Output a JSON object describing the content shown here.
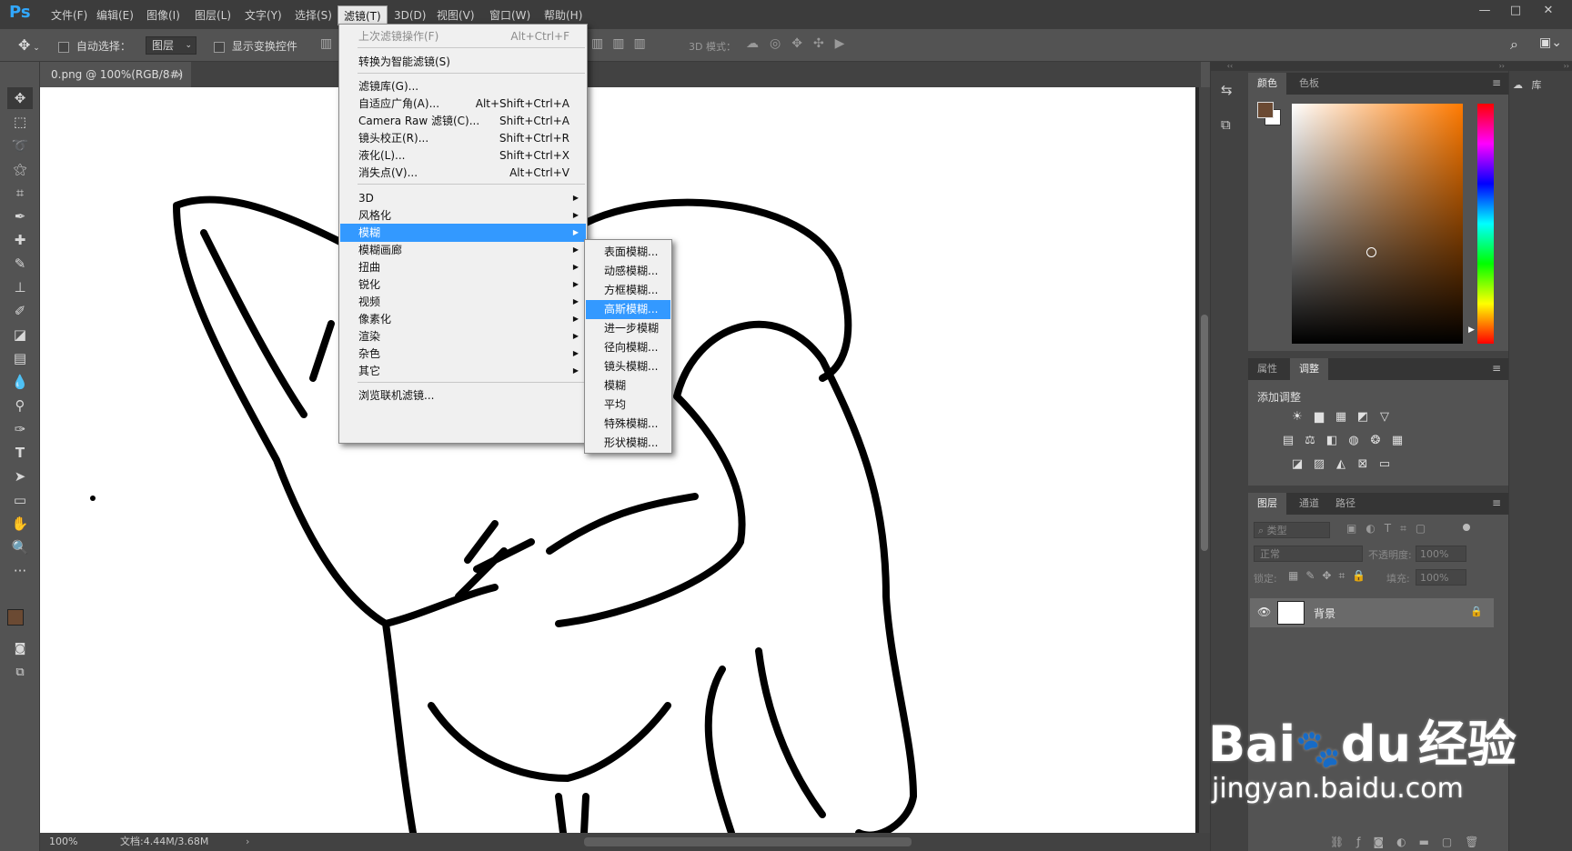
{
  "app": {
    "logo": "Ps"
  },
  "menubar": {
    "items": [
      {
        "label": "文件(F)"
      },
      {
        "label": "编辑(E)"
      },
      {
        "label": "图像(I)"
      },
      {
        "label": "图层(L)"
      },
      {
        "label": "文字(Y)"
      },
      {
        "label": "选择(S)"
      },
      {
        "label": "滤镜(T)"
      },
      {
        "label": "3D(D)"
      },
      {
        "label": "视图(V)"
      },
      {
        "label": "窗口(W)"
      },
      {
        "label": "帮助(H)"
      }
    ],
    "window_controls": {
      "minimize": "—",
      "maximize": "□",
      "close": "✕"
    }
  },
  "options": {
    "auto_select_label": "自动选择：",
    "auto_select_value": "图层",
    "show_transform_label": "显示变换控件",
    "mode_3d_label": "3D 模式："
  },
  "document_tab": {
    "title": "0.png @ 100%(RGB/8#)",
    "close": "×"
  },
  "status": {
    "zoom": "100%",
    "doc": "文档:4.44M/3.68M"
  },
  "filter_menu": {
    "items": [
      {
        "label": "上次滤镜操作(F)",
        "shortcut": "Alt+Ctrl+F"
      },
      {
        "label": "转换为智能滤镜(S)"
      },
      {
        "label": "滤镜库(G)..."
      },
      {
        "label": "自适应广角(A)...",
        "shortcut": "Alt+Shift+Ctrl+A"
      },
      {
        "label": "Camera Raw 滤镜(C)...",
        "shortcut": "Shift+Ctrl+A"
      },
      {
        "label": "镜头校正(R)...",
        "shortcut": "Shift+Ctrl+R"
      },
      {
        "label": "液化(L)...",
        "shortcut": "Shift+Ctrl+X"
      },
      {
        "label": "消失点(V)...",
        "shortcut": "Alt+Ctrl+V"
      },
      {
        "label": "3D"
      },
      {
        "label": "风格化"
      },
      {
        "label": "模糊"
      },
      {
        "label": "模糊画廊"
      },
      {
        "label": "扭曲"
      },
      {
        "label": "锐化"
      },
      {
        "label": "视频"
      },
      {
        "label": "像素化"
      },
      {
        "label": "渲染"
      },
      {
        "label": "杂色"
      },
      {
        "label": "其它"
      },
      {
        "label": "浏览联机滤镜..."
      }
    ]
  },
  "blur_submenu": {
    "items": [
      {
        "label": "表面模糊..."
      },
      {
        "label": "动感模糊..."
      },
      {
        "label": "方框模糊..."
      },
      {
        "label": "高斯模糊..."
      },
      {
        "label": "进一步模糊"
      },
      {
        "label": "径向模糊..."
      },
      {
        "label": "镜头模糊..."
      },
      {
        "label": "模糊"
      },
      {
        "label": "平均"
      },
      {
        "label": "特殊模糊..."
      },
      {
        "label": "形状模糊..."
      }
    ]
  },
  "panels": {
    "color_tabs": [
      "颜色",
      "色板"
    ],
    "props_tabs": [
      "属性",
      "调整"
    ],
    "add_adjustment": "添加调整",
    "layers_tabs": [
      "图层",
      "通道",
      "路径"
    ],
    "filter_kind": "类型",
    "blend_mode": "正常",
    "opacity_label": "不透明度:",
    "opacity_value": "100%",
    "lock_label": "锁定:",
    "fill_label": "填充:",
    "fill_value": "100%",
    "layer_name": "背景",
    "library_label": "库"
  },
  "colors": {
    "foreground": "#6b4a33",
    "background": "#ffffff",
    "accent": "#3399ff"
  },
  "watermark": {
    "brand": "Bai",
    "brand2": "du",
    "cn": "经验",
    "url": "jingyan.baidu.com"
  }
}
